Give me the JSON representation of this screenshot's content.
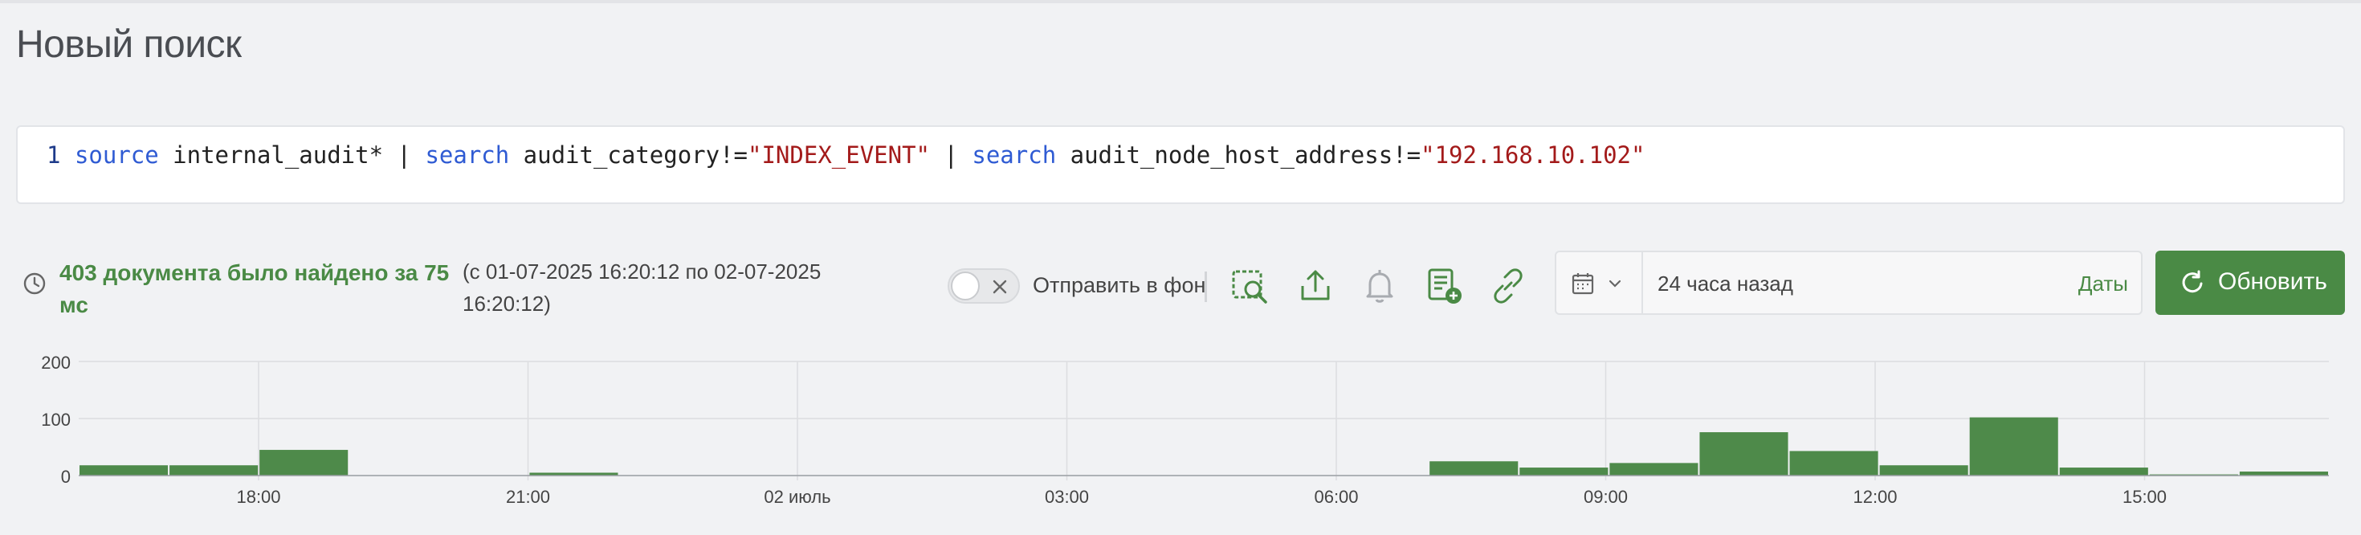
{
  "page": {
    "title": "Новый поиск"
  },
  "query": {
    "line_number": "1",
    "tokens": [
      {
        "text": "source",
        "kind": "kw"
      },
      {
        "text": " internal_audit* | ",
        "kind": "plain"
      },
      {
        "text": "search",
        "kind": "kw"
      },
      {
        "text": " audit_category!=",
        "kind": "plain"
      },
      {
        "text": "\"INDEX_EVENT\"",
        "kind": "str"
      },
      {
        "text": " | ",
        "kind": "plain"
      },
      {
        "text": "search",
        "kind": "kw"
      },
      {
        "text": " audit_node_host_address!=",
        "kind": "plain"
      },
      {
        "text": "\"192.168.10.102\"",
        "kind": "str"
      }
    ]
  },
  "results": {
    "count_text": "403 документа было найдено за 75 мс",
    "range_text": "(с 01-07-2025 16:20:12 по 02-07-2025 16:20:12)"
  },
  "toolbar": {
    "background_toggle_label": "Отправить в фон",
    "background_toggle_on": false,
    "icons": [
      "search-preview-icon",
      "share-icon",
      "bell-icon",
      "add-report-icon",
      "link-icon"
    ]
  },
  "date_picker": {
    "value": "24 часа назад",
    "dates_link": "Даты"
  },
  "refresh": {
    "label": "Обновить"
  },
  "colors": {
    "accent": "#4a8a45",
    "bar": "#4e8a4a",
    "keyword": "#2f5bd3",
    "string": "#a31a1a"
  },
  "chart_data": {
    "type": "bar",
    "y_ticks": [
      "200",
      "100",
      "0"
    ],
    "ylim": [
      0,
      200
    ],
    "x_ticks": [
      "18:00",
      "21:00",
      "02 июль",
      "03:00",
      "06:00",
      "09:00",
      "12:00",
      "15:00"
    ],
    "values": [
      18,
      18,
      45,
      0,
      0,
      5,
      0,
      0,
      0,
      0,
      0,
      0,
      0,
      0,
      0,
      25,
      14,
      22,
      76,
      43,
      18,
      102,
      14,
      2,
      7
    ]
  }
}
